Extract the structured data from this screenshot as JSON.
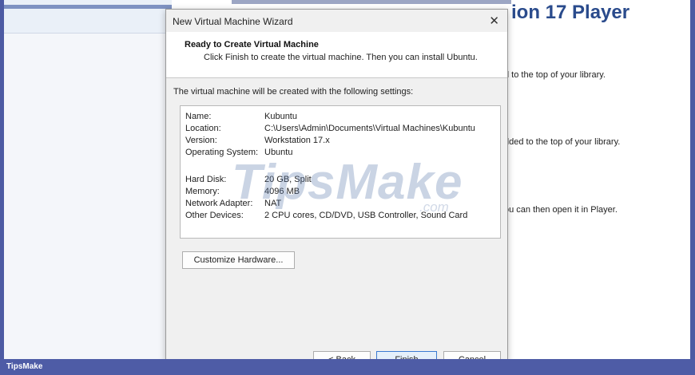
{
  "background": {
    "heading": "ion 17 Player",
    "lines": [
      "d to the top of your library.",
      "dded to the top of your library.",
      "ou can then open it in Player."
    ]
  },
  "dialog": {
    "title": "New Virtual Machine Wizard",
    "close_glyph": "✕",
    "header_title": "Ready to Create Virtual Machine",
    "header_subtitle": "Click Finish to create the virtual machine. Then you can install Ubuntu.",
    "intro": "The virtual machine will be created with the following settings:",
    "settings": [
      {
        "label": "Name:",
        "value": "Kubuntu"
      },
      {
        "label": "Location:",
        "value": "C:\\Users\\Admin\\Documents\\Virtual Machines\\Kubuntu"
      },
      {
        "label": "Version:",
        "value": "Workstation 17.x"
      },
      {
        "label": "Operating System:",
        "value": "Ubuntu"
      },
      {
        "label": "Hard Disk:",
        "value": "20 GB, Split"
      },
      {
        "label": "Memory:",
        "value": "4096 MB"
      },
      {
        "label": "Network Adapter:",
        "value": "NAT"
      },
      {
        "label": "Other Devices:",
        "value": "2 CPU cores, CD/DVD, USB Controller, Sound Card"
      }
    ],
    "customize_label": "Customize Hardware...",
    "back_label": "< Back",
    "finish_label": "Finish",
    "cancel_label": "Cancel"
  },
  "watermark": {
    "text": "TipsMake",
    "suffix": ".com"
  },
  "footer": {
    "brand": "TipsMake"
  },
  "colors": {
    "frame": "#4d5ba3",
    "heading": "#2a4b8c",
    "finish_border": "#3b7bd1"
  }
}
